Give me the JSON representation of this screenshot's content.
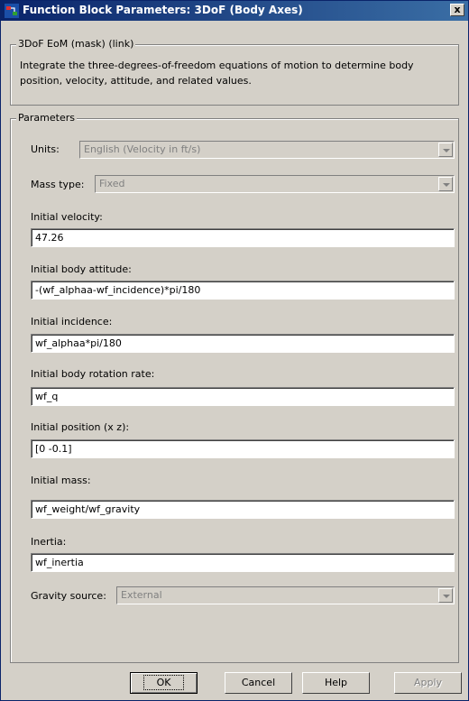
{
  "window": {
    "title": "Function Block Parameters: 3DoF (Body Axes)",
    "close_label": "x"
  },
  "mask_group": {
    "legend": "3DoF EoM (mask) (link)",
    "description": "Integrate the three-degrees-of-freedom equations of motion to determine body position, velocity, attitude, and related values."
  },
  "params": {
    "legend": "Parameters",
    "units_label": "Units:",
    "units_value": "English (Velocity in ft/s)",
    "mass_type_label": "Mass type:",
    "mass_type_value": "Fixed",
    "initial_velocity_label": "Initial velocity:",
    "initial_velocity_value": "47.26",
    "initial_body_attitude_label": "Initial body attitude:",
    "initial_body_attitude_value": "-(wf_alphaa-wf_incidence)*pi/180",
    "initial_incidence_label": "Initial incidence:",
    "initial_incidence_value": "wf_alphaa*pi/180",
    "initial_body_rotation_rate_label": "Initial body rotation rate:",
    "initial_body_rotation_rate_value": "wf_q",
    "initial_position_label": "Initial position (x z):",
    "initial_position_value": "[0 -0.1]",
    "initial_mass_label": "Initial mass:",
    "initial_mass_value": "wf_weight/wf_gravity",
    "inertia_label": "Inertia:",
    "inertia_value": "wf_inertia",
    "gravity_source_label": "Gravity source:",
    "gravity_source_value": "External"
  },
  "buttons": {
    "ok": "OK",
    "cancel": "Cancel",
    "help": "Help",
    "apply": "Apply"
  },
  "colors": {
    "titlebar_start": "#0a246a",
    "titlebar_end": "#3a6ea5",
    "dialog_bg": "#d4d0c8"
  }
}
